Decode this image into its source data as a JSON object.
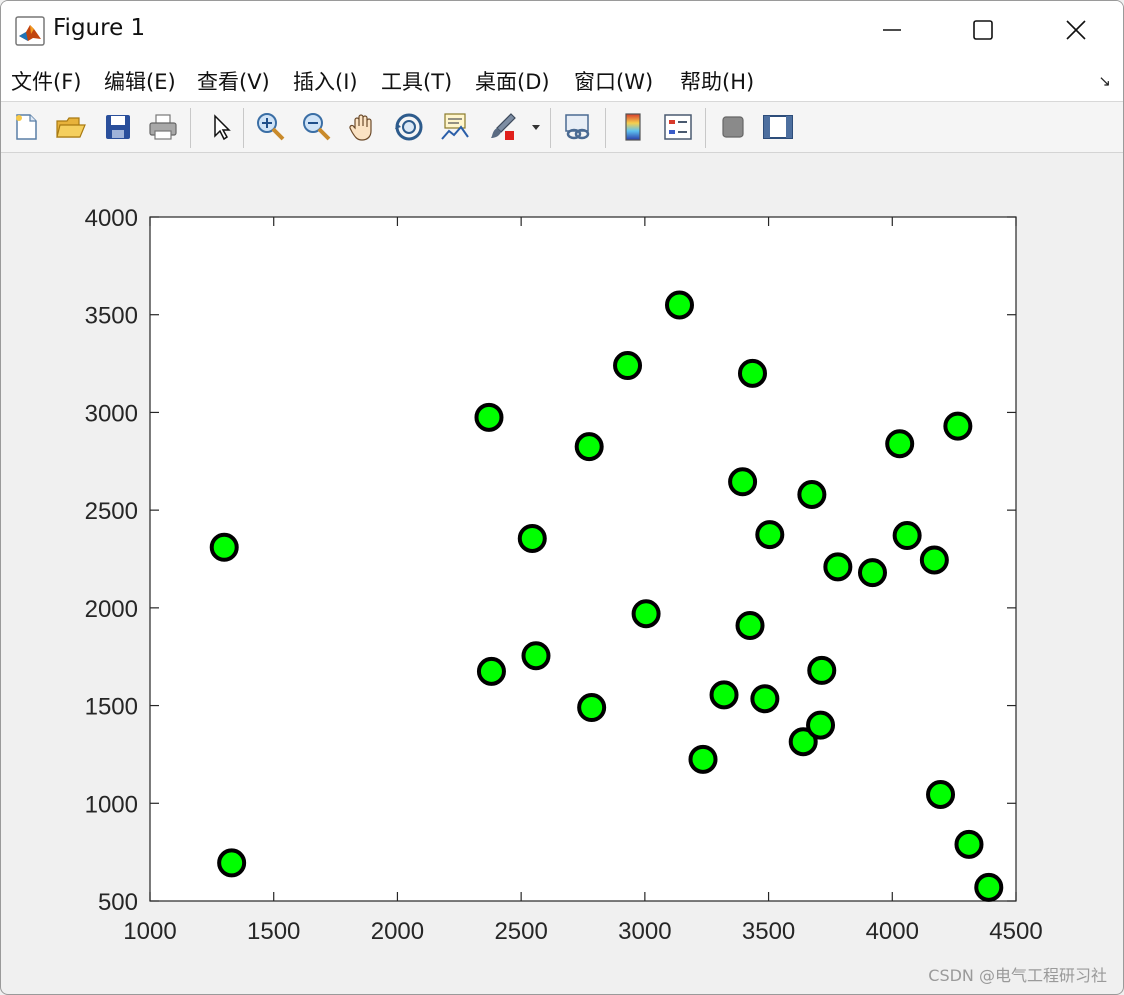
{
  "window": {
    "title": "Figure 1",
    "controls": [
      "minimize",
      "maximize",
      "close"
    ]
  },
  "menubar": {
    "items": [
      "文件(F)",
      "编辑(E)",
      "查看(V)",
      "插入(I)",
      "工具(T)",
      "桌面(D)",
      "窗口(W)",
      "帮助(H)"
    ]
  },
  "toolbar": {
    "buttons": [
      "new-figure-icon",
      "open-file-icon",
      "save-icon",
      "print-icon",
      "pointer-icon",
      "zoom-in-icon",
      "zoom-out-icon",
      "pan-hand-icon",
      "rotate-3d-icon",
      "data-cursor-icon",
      "brush-icon",
      "link-plot-icon",
      "colorbar-icon",
      "legend-icon",
      "hide-plot-tools-icon",
      "show-plot-tools-icon"
    ]
  },
  "watermark": "CSDN @电气工程研习社",
  "chart_data": {
    "type": "scatter",
    "title": "",
    "xlabel": "",
    "ylabel": "",
    "xlim": [
      1000,
      4500
    ],
    "ylim": [
      500,
      4000
    ],
    "xticks": [
      1000,
      1500,
      2000,
      2500,
      3000,
      3500,
      4000,
      4500
    ],
    "yticks": [
      500,
      1000,
      1500,
      2000,
      2500,
      3000,
      3500,
      4000
    ],
    "marker": {
      "shape": "circle",
      "face_color": "#00ff00",
      "edge_color": "#000000"
    },
    "grid": false,
    "points": [
      {
        "x": 1300,
        "y": 2310
      },
      {
        "x": 1330,
        "y": 695
      },
      {
        "x": 2370,
        "y": 2975
      },
      {
        "x": 2380,
        "y": 1675
      },
      {
        "x": 2545,
        "y": 2355
      },
      {
        "x": 2560,
        "y": 1755
      },
      {
        "x": 2775,
        "y": 2825
      },
      {
        "x": 2785,
        "y": 1490
      },
      {
        "x": 2930,
        "y": 3240
      },
      {
        "x": 3005,
        "y": 1970
      },
      {
        "x": 3140,
        "y": 3550
      },
      {
        "x": 3235,
        "y": 1225
      },
      {
        "x": 3320,
        "y": 1555
      },
      {
        "x": 3395,
        "y": 2645
      },
      {
        "x": 3425,
        "y": 1910
      },
      {
        "x": 3435,
        "y": 3200
      },
      {
        "x": 3485,
        "y": 1535
      },
      {
        "x": 3505,
        "y": 2375
      },
      {
        "x": 3640,
        "y": 1315
      },
      {
        "x": 3675,
        "y": 2580
      },
      {
        "x": 3710,
        "y": 1400
      },
      {
        "x": 3715,
        "y": 1680
      },
      {
        "x": 3780,
        "y": 2210
      },
      {
        "x": 3920,
        "y": 2180
      },
      {
        "x": 4030,
        "y": 2840
      },
      {
        "x": 4060,
        "y": 2370
      },
      {
        "x": 4170,
        "y": 2245
      },
      {
        "x": 4195,
        "y": 1045
      },
      {
        "x": 4265,
        "y": 2930
      },
      {
        "x": 4310,
        "y": 790
      },
      {
        "x": 4390,
        "y": 570
      }
    ]
  }
}
